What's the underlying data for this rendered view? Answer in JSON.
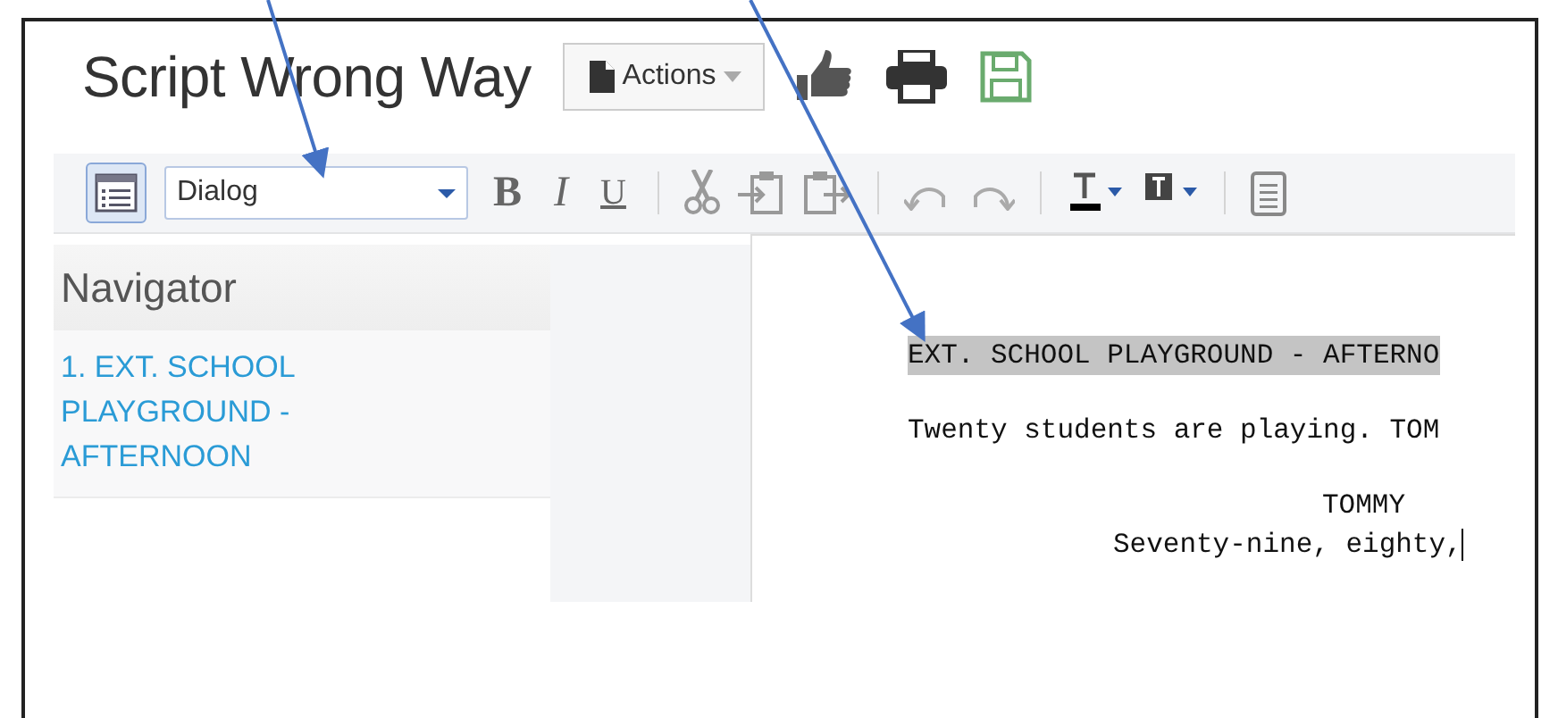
{
  "title": "Script Wrong Way",
  "actions_button": {
    "label": "Actions"
  },
  "toolbar": {
    "navigator_toggle": {
      "selected": true
    },
    "element_type": {
      "value": "Dialog"
    },
    "format_buttons": [
      {
        "label": "B",
        "kind": "bold"
      },
      {
        "label": "I",
        "kind": "italic"
      },
      {
        "label": "U",
        "kind": "underline"
      }
    ]
  },
  "navigator": {
    "heading": "Navigator",
    "scenes": [
      {
        "label": "1. EXT. SCHOOL PLAYGROUND - AFTERNOON",
        "selected": false
      }
    ]
  },
  "script": [
    {
      "kind": "scene_heading",
      "text": "EXT. SCHOOL PLAYGROUND - AFTERNO",
      "highlighted": true
    },
    {
      "kind": "action",
      "text": "Twenty students are playing. TOM",
      "highlighted": false
    },
    {
      "kind": "character",
      "text": "TOMMY",
      "highlighted": false
    },
    {
      "kind": "dialogue",
      "text": "Seventy-nine, eighty,",
      "highlighted": false,
      "cursor": true
    }
  ]
}
